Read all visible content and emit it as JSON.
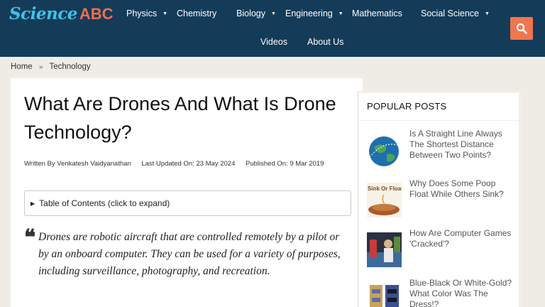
{
  "logo": {
    "word1": "Science",
    "word2": "ABC"
  },
  "nav": {
    "physics": "Physics",
    "chemistry": "Chemistry",
    "biology": "Biology",
    "engineering": "Engineering",
    "mathematics": "Mathematics",
    "social_science": "Social Science",
    "videos": "Videos",
    "about": "About Us",
    "caret": "▼"
  },
  "breadcrumb": {
    "home": "Home",
    "sep": "»",
    "current": "Technology"
  },
  "article": {
    "title": "What Are Drones And What Is Drone Technology?",
    "author": "Written By Venkatesh Vaidyanathan",
    "updated": "Last Updated On: 23 May 2024",
    "published": "Published On: 9 Mar 2019",
    "toc_marker": "▶",
    "toc_label": "Table of Contents (click to expand)",
    "quote_mark": "❝",
    "lead": "Drones are robotic aircraft that are controlled remotely by a pilot or by an onboard computer. They can be used for a variety of purposes, including surveillance, photography, and recreation."
  },
  "sidebar": {
    "heading": "POPULAR POSTS",
    "posts": [
      {
        "title": "Is A Straight Line Always The Shortest Distance Between Two Points?"
      },
      {
        "title": "Why Does Some Poop Float While Others Sink?",
        "thumb_text": "Sink Or Float"
      },
      {
        "title": "How Are Computer Games 'Cracked'?"
      },
      {
        "title": "Blue-Black Or White-Gold? What Color Was The Dress!?"
      }
    ]
  },
  "colors": {
    "header_bg": "#143c59",
    "accent": "#f0764f",
    "logo_blue": "#3fc2e6"
  }
}
